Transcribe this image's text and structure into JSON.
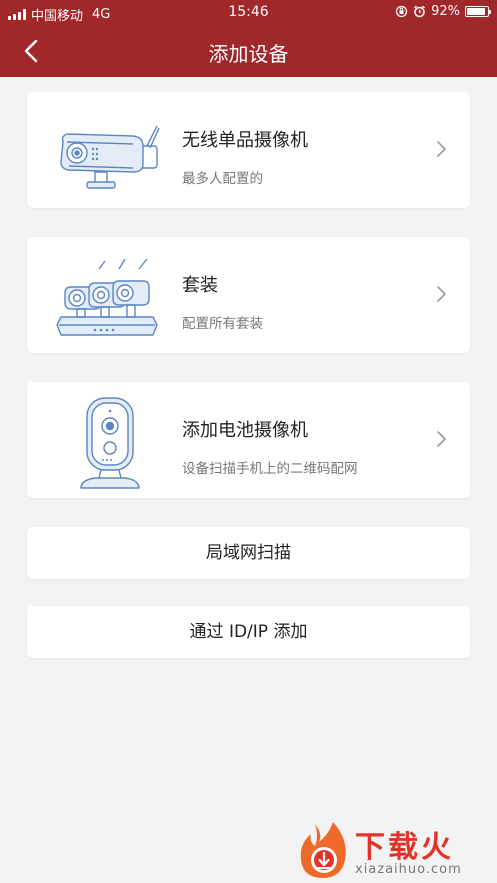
{
  "status_bar": {
    "carrier": "中国移动",
    "network": "4G",
    "time": "15:46",
    "battery": "92%",
    "battery_level": 0.92
  },
  "navbar": {
    "title": "添加设备",
    "back_icon": "chevron-left-icon"
  },
  "options": [
    {
      "title": "无线单品摄像机",
      "subtitle": "最多人配置的",
      "icon": "bullet-camera-icon"
    },
    {
      "title": "套装",
      "subtitle": "配置所有套装",
      "icon": "camera-kit-icon"
    },
    {
      "title": "添加电池摄像机",
      "subtitle": "设备扫描手机上的二维码配网",
      "icon": "battery-camera-icon"
    }
  ],
  "actions": {
    "lan_scan": "局域网扫描",
    "add_by_id": "通过 ID/IP 添加"
  },
  "watermark": {
    "text": "下载火",
    "url": "xiazaihuo.com"
  },
  "colors": {
    "header": "#a0272a",
    "background": "#f3f3f3",
    "illustration_stroke": "#5b86c4",
    "watermark_red": "#e0342a"
  }
}
